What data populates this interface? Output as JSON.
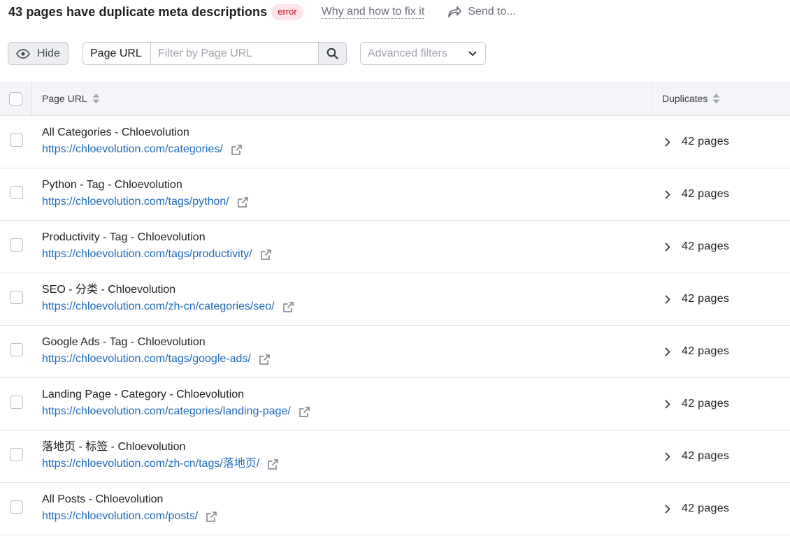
{
  "header": {
    "title": "43 pages have duplicate meta descriptions",
    "badge": "error",
    "help_link": "Why and how to fix it",
    "send_label": "Send to..."
  },
  "toolbar": {
    "hide_label": "Hide",
    "filter_field_label": "Page URL",
    "filter_placeholder": "Filter by Page URL",
    "filter_value": "",
    "advanced_filters_label": "Advanced filters"
  },
  "table": {
    "columns": [
      "Page URL",
      "Duplicates"
    ],
    "rows": [
      {
        "title": "All Categories - Chloevolution",
        "url": "https://chloevolution.com/categories/",
        "duplicates": "42 pages"
      },
      {
        "title": "Python - Tag - Chloevolution",
        "url": "https://chloevolution.com/tags/python/",
        "duplicates": "42 pages"
      },
      {
        "title": "Productivity - Tag - Chloevolution",
        "url": "https://chloevolution.com/tags/productivity/",
        "duplicates": "42 pages"
      },
      {
        "title": "SEO - 分类 - Chloevolution",
        "url": "https://chloevolution.com/zh-cn/categories/seo/",
        "duplicates": "42 pages"
      },
      {
        "title": "Google Ads - Tag - Chloevolution",
        "url": "https://chloevolution.com/tags/google-ads/",
        "duplicates": "42 pages"
      },
      {
        "title": "Landing Page - Category - Chloevolution",
        "url": "https://chloevolution.com/categories/landing-page/",
        "duplicates": "42 pages"
      },
      {
        "title": "落地页 - 标签 - Chloevolution",
        "url": "https://chloevolution.com/zh-cn/tags/落地页/",
        "duplicates": "42 pages"
      },
      {
        "title": "All Posts - Chloevolution",
        "url": "https://chloevolution.com/posts/",
        "duplicates": "42 pages"
      }
    ]
  },
  "icons": {
    "send": "share-arrow-icon",
    "hide": "eye-icon",
    "search": "search-icon",
    "dropdown": "chevron-down-icon",
    "sort": "sort-icon",
    "external": "external-link-icon",
    "expand": "chevron-right-icon"
  },
  "colors": {
    "accent_link": "#1c6bbd",
    "error_badge_bg": "#ffe4ea",
    "error_badge_text": "#d0021b",
    "header_bg": "#f4f5f9"
  }
}
